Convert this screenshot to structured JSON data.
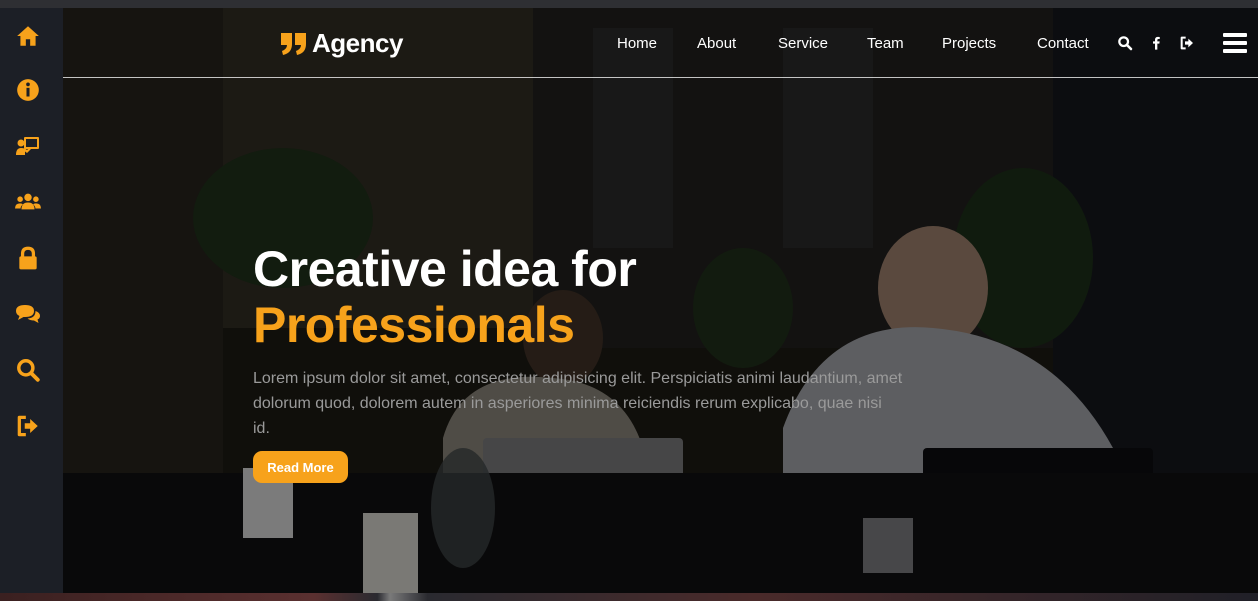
{
  "brand": {
    "name": "Agency",
    "accent": "#f7a21b"
  },
  "nav": {
    "links": [
      "Home",
      "About",
      "Service",
      "Team",
      "Projects",
      "Contact"
    ],
    "icons": [
      "search-icon",
      "facebook-icon",
      "sign-out-icon",
      "menu-icon"
    ]
  },
  "sidebar": {
    "items": [
      "home-icon",
      "info-icon",
      "presentation-icon",
      "team-icon",
      "lock-icon",
      "comments-icon",
      "search-icon",
      "sign-out-icon"
    ]
  },
  "hero": {
    "headline_line1": "Creative idea for",
    "headline_line2": "Professionals",
    "body": "Lorem ipsum dolor sit amet, consectetur adipisicing elit. Perspiciatis animi laudantium, amet dolorum quod, dolorem autem in asperiores minima reiciendis rerum explicabo, quae nisi id.",
    "cta_label": "Read More"
  },
  "colors": {
    "accent": "#f7a21b",
    "sidebar_bg": "#1c1f26",
    "text": "#ffffff",
    "muted": "#9a9a9a"
  }
}
